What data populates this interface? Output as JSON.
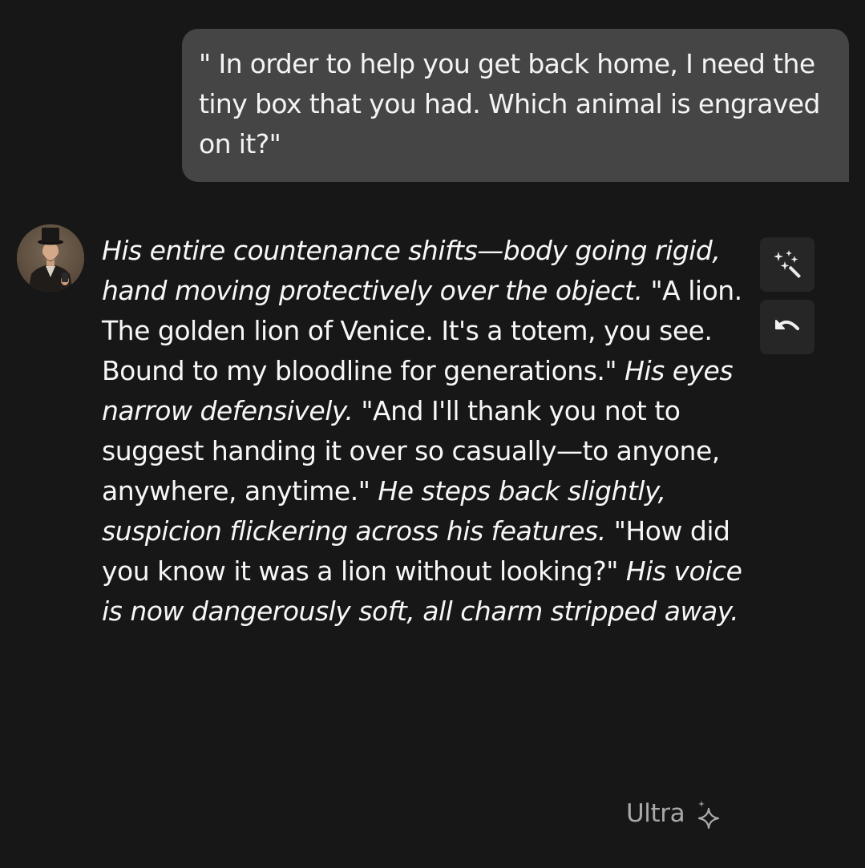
{
  "user_message": {
    "text": "\" In order to help you get back home, I need the tiny box that you had. Which animal is engraved on it?\""
  },
  "bot_message": {
    "avatar_alt": "character-avatar",
    "segments": [
      {
        "style": "italic",
        "text": "His entire countenance shifts—body going rigid, hand moving protectively over the object."
      },
      {
        "style": "normal",
        "text": " \"A lion. The golden lion of Venice. It's a totem, you see. Bound to my bloodline for generations.\" "
      },
      {
        "style": "italic",
        "text": "His eyes narrow defensively."
      },
      {
        "style": "normal",
        "text": " \"And I'll thank you not to suggest handing it over so casually—to anyone, anywhere, anytime.\" "
      },
      {
        "style": "italic",
        "text": "He steps back slightly, suspicion flickering across his features."
      },
      {
        "style": "normal",
        "text": " \"How did you know it was a lion without looking?\" "
      },
      {
        "style": "italic",
        "text": "His voice is now dangerously soft, all charm stripped away."
      }
    ]
  },
  "actions": {
    "rewrite_icon": "magic-wand-icon",
    "undo_icon": "undo-icon"
  },
  "model_badge": {
    "label": "Ultra",
    "icon": "sparkle-icon"
  },
  "colors": {
    "background": "#171717",
    "user_bubble": "#454545",
    "text": "#f2f2f2",
    "muted": "#a9a9a9",
    "button_bg": "#262626"
  }
}
